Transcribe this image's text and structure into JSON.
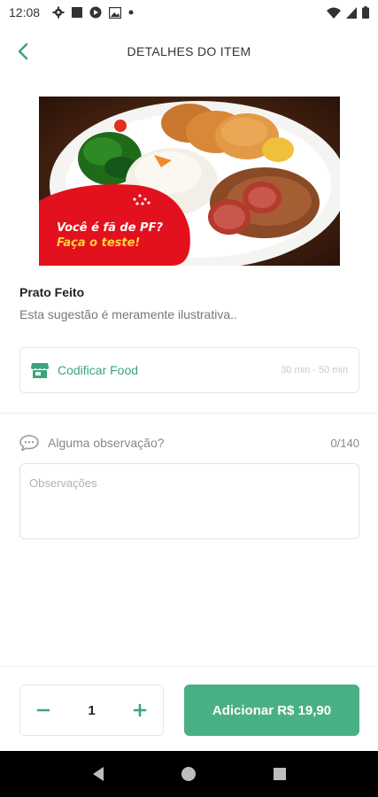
{
  "status_bar": {
    "time": "12:08",
    "icons": [
      "gear-icon",
      "square-icon",
      "play-icon",
      "image-icon",
      "dot-icon"
    ],
    "right_icons": [
      "wifi-icon",
      "signal-icon",
      "battery-icon"
    ]
  },
  "header": {
    "title": "DETALHES DO ITEM",
    "back_icon": "chevron-left-icon"
  },
  "hero": {
    "promo_line1": "Você é fã de PF?",
    "promo_line2": "Faça o teste!"
  },
  "item": {
    "name": "Prato Feito",
    "description": "Esta sugestão é meramente ilustrativa.."
  },
  "store": {
    "icon": "store-icon",
    "name": "Codificar Food",
    "delivery_time": "30 min - 50 min"
  },
  "observation": {
    "icon": "chat-bubble-icon",
    "label": "Alguma observação?",
    "counter": "0/140",
    "placeholder": "Observações",
    "value": ""
  },
  "order": {
    "quantity": "1",
    "minus_icon": "minus-icon",
    "plus_icon": "plus-icon",
    "add_label": "Adicionar R$ 19,90"
  },
  "nav": {
    "icons": [
      "back-triangle-icon",
      "home-circle-icon",
      "recents-square-icon"
    ]
  },
  "colors": {
    "accent": "#49b083",
    "accent_text": "#3aa57a",
    "promo_red": "#e3101e",
    "promo_yellow": "#ffd23c"
  }
}
